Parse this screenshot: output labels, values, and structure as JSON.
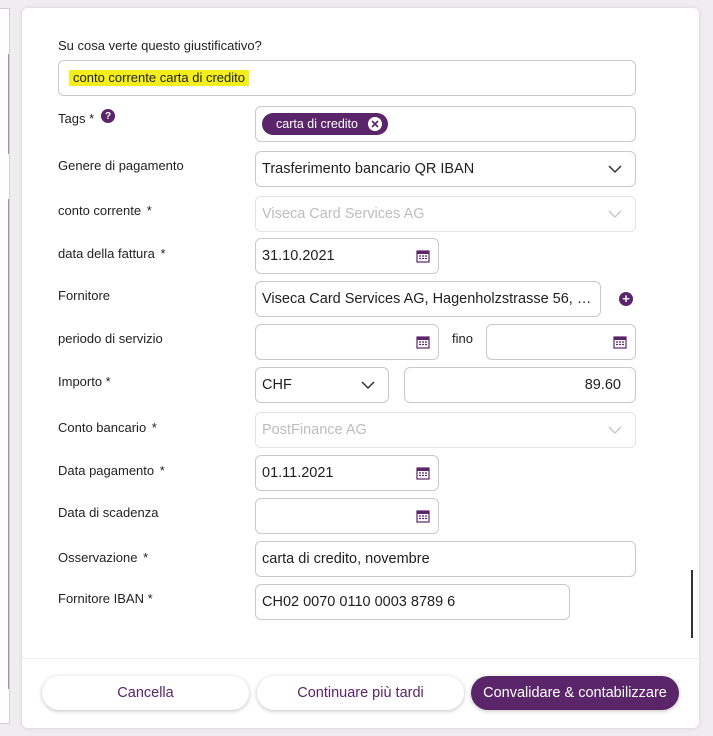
{
  "form": {
    "subject": {
      "label": "Su cosa verte questo giustificativo?",
      "value": "conto corrente carta di credito"
    },
    "tags": {
      "label": "Tags *",
      "help_icon": "question-icon",
      "chip": "carta di credito"
    },
    "payment_type": {
      "label": "Genere di pagamento",
      "value": "Trasferimento bancario QR IBAN"
    },
    "account": {
      "label": "conto corrente",
      "required": "*",
      "value": "Viseca Card Services AG"
    },
    "invoice_date": {
      "label": "data della fattura",
      "required": "*",
      "value": "31.10.2021"
    },
    "supplier": {
      "label": "Fornitore",
      "value": "Viseca Card Services AG, Hagenholzstrasse 56, 8 ..."
    },
    "service_period": {
      "label": "periodo di servizio",
      "to_label": "fino",
      "from_value": "",
      "to_value": ""
    },
    "amount": {
      "label": "Importo *",
      "currency": "CHF",
      "value": "89.60"
    },
    "bank_account": {
      "label": "Conto bancario",
      "required": "*",
      "value": "PostFinance AG"
    },
    "payment_date": {
      "label": "Data pagamento",
      "required": "*",
      "value": "01.11.2021"
    },
    "due_date": {
      "label": "Data di scadenza",
      "value": ""
    },
    "note": {
      "label": "Osservazione",
      "required": "*",
      "value": "carta di credito, novembre"
    },
    "supplier_iban": {
      "label": "Fornitore IBAN *",
      "value": "CH02 0070 0110 0003 8789 6"
    }
  },
  "footer": {
    "cancel": "Cancella",
    "later": "Continuare più tardi",
    "submit": "Convalidare & contabilizzare"
  },
  "colors": {
    "accent": "#5a2569",
    "highlight": "#f4ef1c"
  }
}
